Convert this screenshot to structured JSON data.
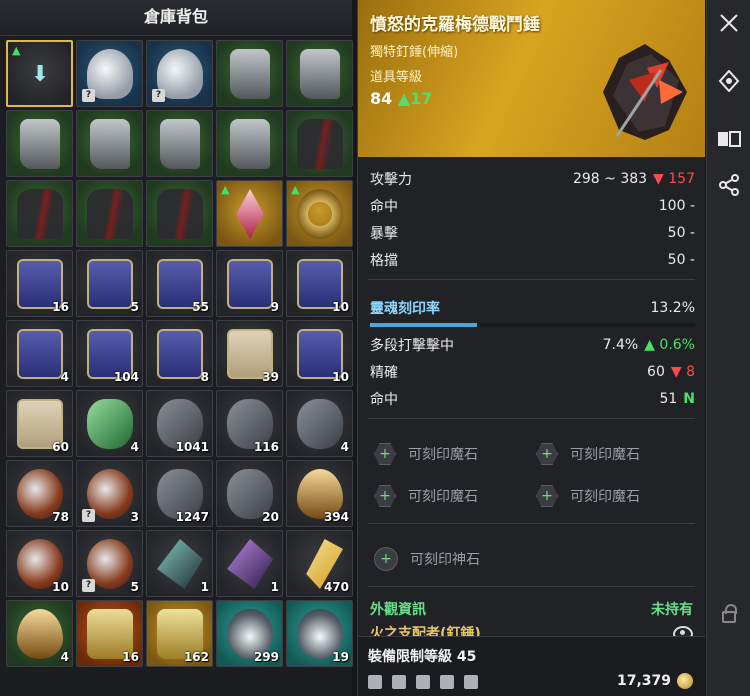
{
  "inventory": {
    "title": "倉庫背包",
    "slots": [
      {
        "art": "arrow",
        "bg": "gray",
        "count": "",
        "locked": false,
        "upgrade": true,
        "selected": true
      },
      {
        "art": "helm",
        "bg": "blue",
        "count": "",
        "locked": true,
        "upgrade": false
      },
      {
        "art": "helm",
        "bg": "blue",
        "count": "",
        "locked": true,
        "upgrade": false
      },
      {
        "art": "boots",
        "bg": "green",
        "count": "",
        "locked": false,
        "upgrade": false
      },
      {
        "art": "boots",
        "bg": "green",
        "count": "",
        "locked": false,
        "upgrade": false
      },
      {
        "art": "boots",
        "bg": "green",
        "count": "",
        "locked": false,
        "upgrade": false
      },
      {
        "art": "boots",
        "bg": "green",
        "count": "",
        "locked": false,
        "upgrade": false
      },
      {
        "art": "boots",
        "bg": "green",
        "count": "",
        "locked": false,
        "upgrade": false
      },
      {
        "art": "boots",
        "bg": "green",
        "count": "",
        "locked": false,
        "upgrade": false
      },
      {
        "art": "cloak",
        "bg": "green",
        "count": "",
        "locked": false,
        "upgrade": false
      },
      {
        "art": "cloak",
        "bg": "green",
        "count": "",
        "locked": false,
        "upgrade": false
      },
      {
        "art": "cloak",
        "bg": "green",
        "count": "",
        "locked": false,
        "upgrade": false
      },
      {
        "art": "cloak",
        "bg": "green",
        "count": "",
        "locked": false,
        "upgrade": false
      },
      {
        "art": "pendant",
        "bg": "gold",
        "count": "",
        "locked": false,
        "upgrade": true
      },
      {
        "art": "ring",
        "bg": "gold",
        "count": "",
        "locked": false,
        "upgrade": true
      },
      {
        "art": "scroll",
        "bg": "gray",
        "count": "16",
        "locked": false,
        "upgrade": false
      },
      {
        "art": "scroll",
        "bg": "gray",
        "count": "5",
        "locked": false,
        "upgrade": false
      },
      {
        "art": "scroll",
        "bg": "gray",
        "count": "55",
        "locked": false,
        "upgrade": false
      },
      {
        "art": "scroll",
        "bg": "gray",
        "count": "9",
        "locked": false,
        "upgrade": false
      },
      {
        "art": "scroll",
        "bg": "gray",
        "count": "10",
        "locked": false,
        "upgrade": false
      },
      {
        "art": "scroll",
        "bg": "gray",
        "count": "4",
        "locked": false,
        "upgrade": false
      },
      {
        "art": "scroll",
        "bg": "gray",
        "count": "104",
        "locked": false,
        "upgrade": false
      },
      {
        "art": "scroll",
        "bg": "gray",
        "count": "8",
        "locked": false,
        "upgrade": false
      },
      {
        "art": "scroll light",
        "bg": "gray",
        "count": "39",
        "locked": false,
        "upgrade": false
      },
      {
        "art": "scroll",
        "bg": "gray",
        "count": "10",
        "locked": false,
        "upgrade": false
      },
      {
        "art": "scroll light",
        "bg": "gray",
        "count": "60",
        "locked": false,
        "upgrade": false
      },
      {
        "art": "gem",
        "bg": "gray",
        "count": "4",
        "locked": false,
        "upgrade": false
      },
      {
        "art": "stone",
        "bg": "gray",
        "count": "1041",
        "locked": false,
        "upgrade": false
      },
      {
        "art": "stone",
        "bg": "gray",
        "count": "116",
        "locked": false,
        "upgrade": false
      },
      {
        "art": "stone",
        "bg": "gray",
        "count": "4",
        "locked": false,
        "upgrade": false
      },
      {
        "art": "orb",
        "bg": "gray",
        "count": "78",
        "locked": false,
        "upgrade": false
      },
      {
        "art": "orb",
        "bg": "gray",
        "count": "3",
        "locked": true,
        "upgrade": false
      },
      {
        "art": "stone",
        "bg": "gray",
        "count": "1247",
        "locked": false,
        "upgrade": false
      },
      {
        "art": "stone",
        "bg": "gray",
        "count": "20",
        "locked": false,
        "upgrade": false
      },
      {
        "art": "drop",
        "bg": "gray",
        "count": "394",
        "locked": false,
        "upgrade": false
      },
      {
        "art": "orb",
        "bg": "gray",
        "count": "10",
        "locked": false,
        "upgrade": false
      },
      {
        "art": "orb",
        "bg": "gray",
        "count": "5",
        "locked": true,
        "upgrade": false
      },
      {
        "art": "shard",
        "bg": "gray",
        "count": "1",
        "locked": false,
        "upgrade": false
      },
      {
        "art": "shard purple",
        "bg": "gray",
        "count": "1",
        "locked": false,
        "upgrade": false
      },
      {
        "art": "feather",
        "bg": "gray",
        "count": "470",
        "locked": false,
        "upgrade": false
      },
      {
        "art": "drop",
        "bg": "green",
        "count": "4",
        "locked": false,
        "upgrade": false
      },
      {
        "art": "bracer",
        "bg": "orange",
        "count": "16",
        "locked": false,
        "upgrade": false
      },
      {
        "art": "bracer",
        "bg": "gold",
        "count": "162",
        "locked": false,
        "upgrade": false
      },
      {
        "art": "amulet",
        "bg": "teal",
        "count": "299",
        "locked": false,
        "upgrade": false
      },
      {
        "art": "amulet",
        "bg": "teal",
        "count": "19",
        "locked": false,
        "upgrade": false
      }
    ]
  },
  "tooltip": {
    "name": "憤怒的克羅梅德戰鬥錘",
    "type": "獨特釘錘(伸縮)",
    "level_label": "道具等級",
    "level_value": "84",
    "level_bonus": "17",
    "stats": [
      {
        "label": "攻擊力",
        "value": "298 ~ 383",
        "delta": "157",
        "dir": "down"
      },
      {
        "label": "命中",
        "value": "100 -",
        "delta": "",
        "dir": ""
      },
      {
        "label": "暴擊",
        "value": "50 -",
        "delta": "",
        "dir": ""
      },
      {
        "label": "格擋",
        "value": "50 -",
        "delta": "",
        "dir": ""
      }
    ],
    "soul": {
      "label": "靈魂刻印率",
      "value": "13.2%",
      "fill": 0.132
    },
    "soul_stats": [
      {
        "label": "多段打擊擊中",
        "value": "7.4%",
        "delta": "0.6%",
        "dir": "up"
      },
      {
        "label": "精確",
        "value": "60",
        "delta": "8",
        "dir": "down"
      },
      {
        "label": "命中",
        "value": "51",
        "delta": "N",
        "dir": "new"
      }
    ],
    "sockets": [
      [
        "可刻印魔石",
        "可刻印魔石"
      ],
      [
        "可刻印魔石",
        "可刻印魔石"
      ]
    ],
    "divine_socket": "可刻印神石",
    "appearance": {
      "label": "外觀資訊",
      "status": "未持有",
      "name": "火之支配者(釘錘)"
    },
    "requirement": "裝備限制等級 45",
    "price": "17,379"
  },
  "sidebar": {
    "buttons": [
      "close-icon",
      "compass-icon",
      "compare-icon",
      "share-icon"
    ]
  },
  "colors": {
    "header_gold": "#d8a51f",
    "up_green": "#4fe06a",
    "down_red": "#ff4a4a",
    "soul_blue": "#8fd6ff",
    "appearance_name": "#e8c66a"
  }
}
